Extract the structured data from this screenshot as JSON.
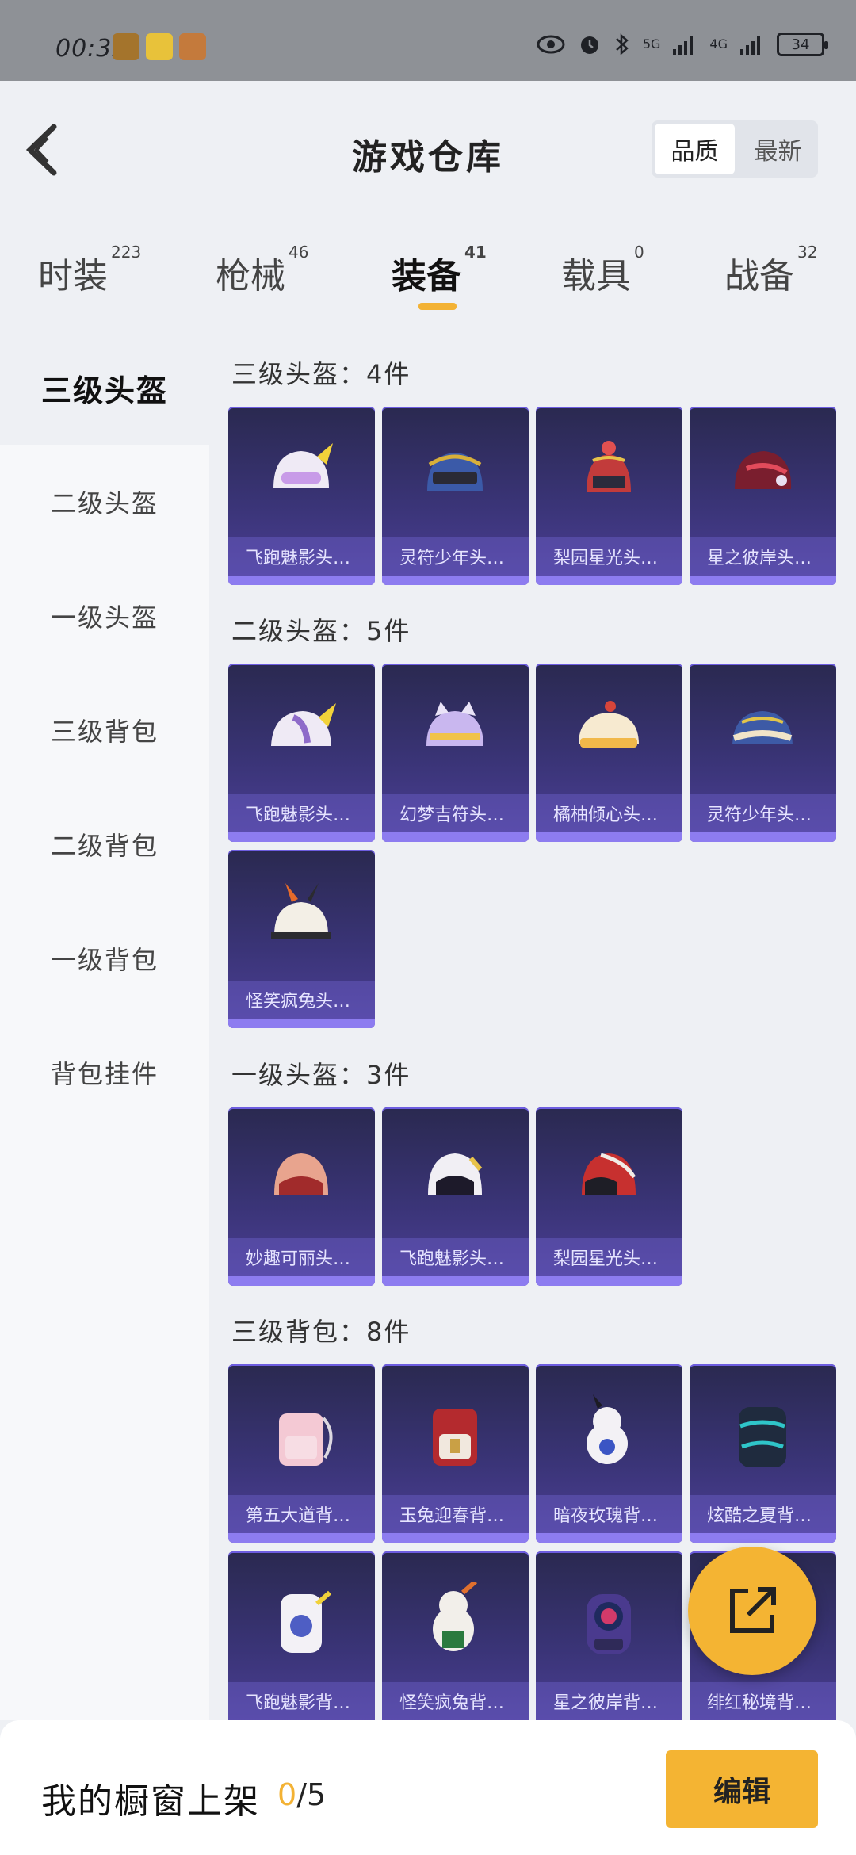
{
  "status_bar": {
    "time": "00:32",
    "network_1": "5G",
    "network_2": "4G",
    "battery": "34"
  },
  "header": {
    "title": "游戏仓库",
    "sort_quality": "品质",
    "sort_newest": "最新"
  },
  "tabs": [
    {
      "label": "时装",
      "count": "223"
    },
    {
      "label": "枪械",
      "count": "46"
    },
    {
      "label": "装备",
      "count": "41"
    },
    {
      "label": "载具",
      "count": "0"
    },
    {
      "label": "战备",
      "count": "32"
    }
  ],
  "sidebar": {
    "items": [
      {
        "label": "三级头盔"
      },
      {
        "label": "二级头盔"
      },
      {
        "label": "一级头盔"
      },
      {
        "label": "三级背包"
      },
      {
        "label": "二级背包"
      },
      {
        "label": "一级背包"
      },
      {
        "label": "背包挂件"
      }
    ]
  },
  "sections": [
    {
      "title": "三级头盔：4件",
      "items": [
        {
          "name": "飞跑魅影头…"
        },
        {
          "name": "灵符少年头…"
        },
        {
          "name": "梨园星光头…"
        },
        {
          "name": "星之彼岸头…"
        }
      ]
    },
    {
      "title": "二级头盔：5件",
      "items": [
        {
          "name": "飞跑魅影头…"
        },
        {
          "name": "幻梦吉符头…"
        },
        {
          "name": "橘柚倾心头…"
        },
        {
          "name": "灵符少年头…"
        },
        {
          "name": "怪笑疯兔头…"
        }
      ]
    },
    {
      "title": "一级头盔：3件",
      "items": [
        {
          "name": "妙趣可丽头…"
        },
        {
          "name": "飞跑魅影头…"
        },
        {
          "name": "梨园星光头…"
        }
      ]
    },
    {
      "title": "三级背包：8件",
      "items": [
        {
          "name": "第五大道背…"
        },
        {
          "name": "玉兔迎春背…"
        },
        {
          "name": "暗夜玫瑰背…"
        },
        {
          "name": "炫酷之夏背…"
        },
        {
          "name": "飞跑魅影背…"
        },
        {
          "name": "怪笑疯兔背…"
        },
        {
          "name": "星之彼岸背…"
        },
        {
          "name": "绯红秘境背…"
        }
      ]
    }
  ],
  "bottom_bar": {
    "label": "我的橱窗上架",
    "count_current": "0",
    "count_total": "/5",
    "edit_label": "编辑"
  },
  "icons": {
    "back": "chevron-left-icon",
    "share": "external-link-icon",
    "eye": "eye-icon",
    "alarm": "alarm-icon",
    "bluetooth": "bluetooth-icon"
  },
  "colors": {
    "accent": "#f4b433",
    "card_top": "#2a2950",
    "card_bottom": "#4c3f96",
    "card_bar": "#8d7cf0"
  }
}
